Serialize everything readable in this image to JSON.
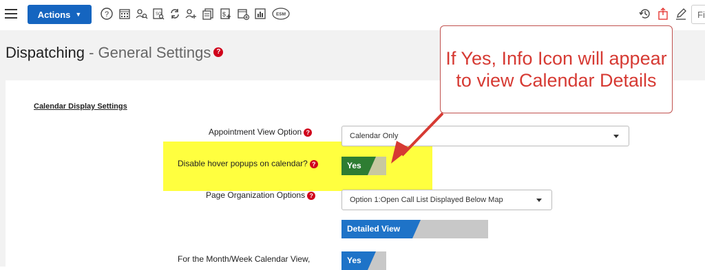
{
  "toolbar": {
    "actions_label": "Actions",
    "icons": [
      "menu-icon",
      "help-icon",
      "calendar-grid-icon",
      "user-search-icon",
      "document-search-icon",
      "refresh-icon",
      "add-user-icon",
      "copy-icon",
      "add-dollar-icon",
      "add-calendar-icon",
      "bar-chart-icon",
      "esm-icon",
      "history-icon",
      "share-icon",
      "edit-icon"
    ],
    "esm_label": "ESM",
    "search_placeholder": "Fi"
  },
  "page": {
    "title": "Dispatching",
    "separator": " - ",
    "subtitle": "General Settings",
    "help_glyph": "?"
  },
  "callout": {
    "text": "If Yes, Info Icon will appear to view Calendar Details",
    "border_color": "#c0504d",
    "text_color": "#d63a33"
  },
  "settings": {
    "section_title": "Calendar Display Settings",
    "appointment_view": {
      "label": "Appointment View Option",
      "value": "Calendar Only"
    },
    "disable_hover": {
      "label": "Disable hover popups on calendar?",
      "value": "Yes"
    },
    "page_org": {
      "label": "Page Organization Options",
      "value": "Option 1:Open Call List Displayed Below Map"
    },
    "detail_toggle": {
      "value": "Detailed View"
    },
    "month_week": {
      "label": "For the Month/Week Calendar View,",
      "value": "Yes"
    }
  },
  "colors": {
    "accent": "#1565c0",
    "toggle_blue": "#1e73c8",
    "toggle_green": "#2e7d32",
    "toggle_off": "#c8c8c8",
    "highlight": "#ffff3f",
    "help_red": "#d0021b"
  }
}
